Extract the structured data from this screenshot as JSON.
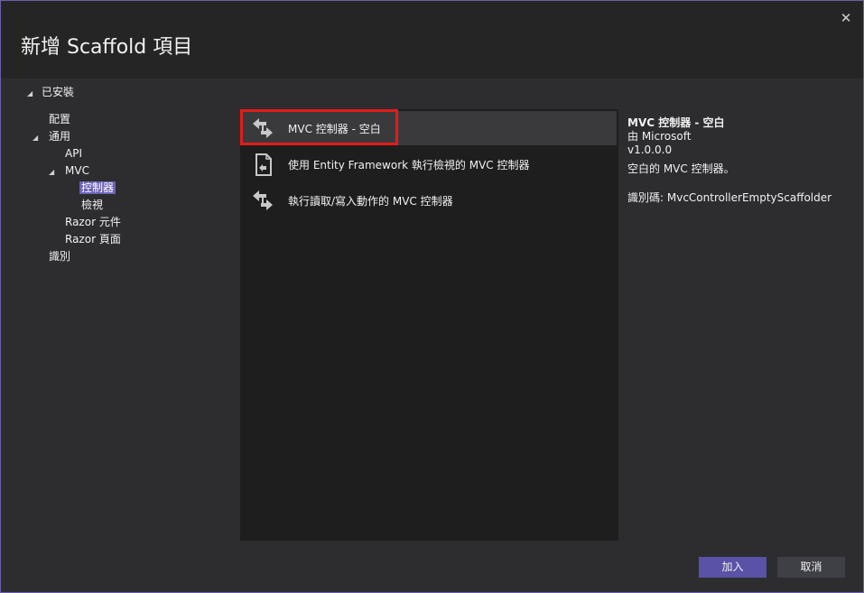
{
  "window": {
    "title": "新增 Scaffold 項目",
    "close_glyph": "✕"
  },
  "tree": {
    "root_label": "已安裝",
    "items": [
      {
        "label": "配置"
      },
      {
        "label": "通用"
      },
      {
        "label": "API"
      },
      {
        "label": "MVC"
      },
      {
        "label": "控制器"
      },
      {
        "label": "檢視"
      },
      {
        "label": "Razor 元件"
      },
      {
        "label": "Razor 頁面"
      },
      {
        "label": "識別"
      }
    ]
  },
  "templates": [
    {
      "label": "MVC 控制器 - 空白",
      "icon": "controller-icon",
      "selected": true
    },
    {
      "label": "使用 Entity Framework 執行檢視的 MVC 控制器",
      "icon": "entity-framework-controller-icon"
    },
    {
      "label": "執行讀取/寫入動作的 MVC 控制器",
      "icon": "controller-icon"
    }
  ],
  "details": {
    "title": "MVC 控制器 - 空白",
    "author": "由 Microsoft",
    "version": "v1.0.0.0",
    "description": "空白的 MVC 控制器。",
    "id": "識別碼: MvcControllerEmptyScaffolder"
  },
  "footer": {
    "add_label": "加入",
    "cancel_label": "取消"
  },
  "colors": {
    "accent": "#6c63b5",
    "highlight": "#e31b1b",
    "background": "#2d2d30",
    "list_background": "#1e1e1e"
  }
}
